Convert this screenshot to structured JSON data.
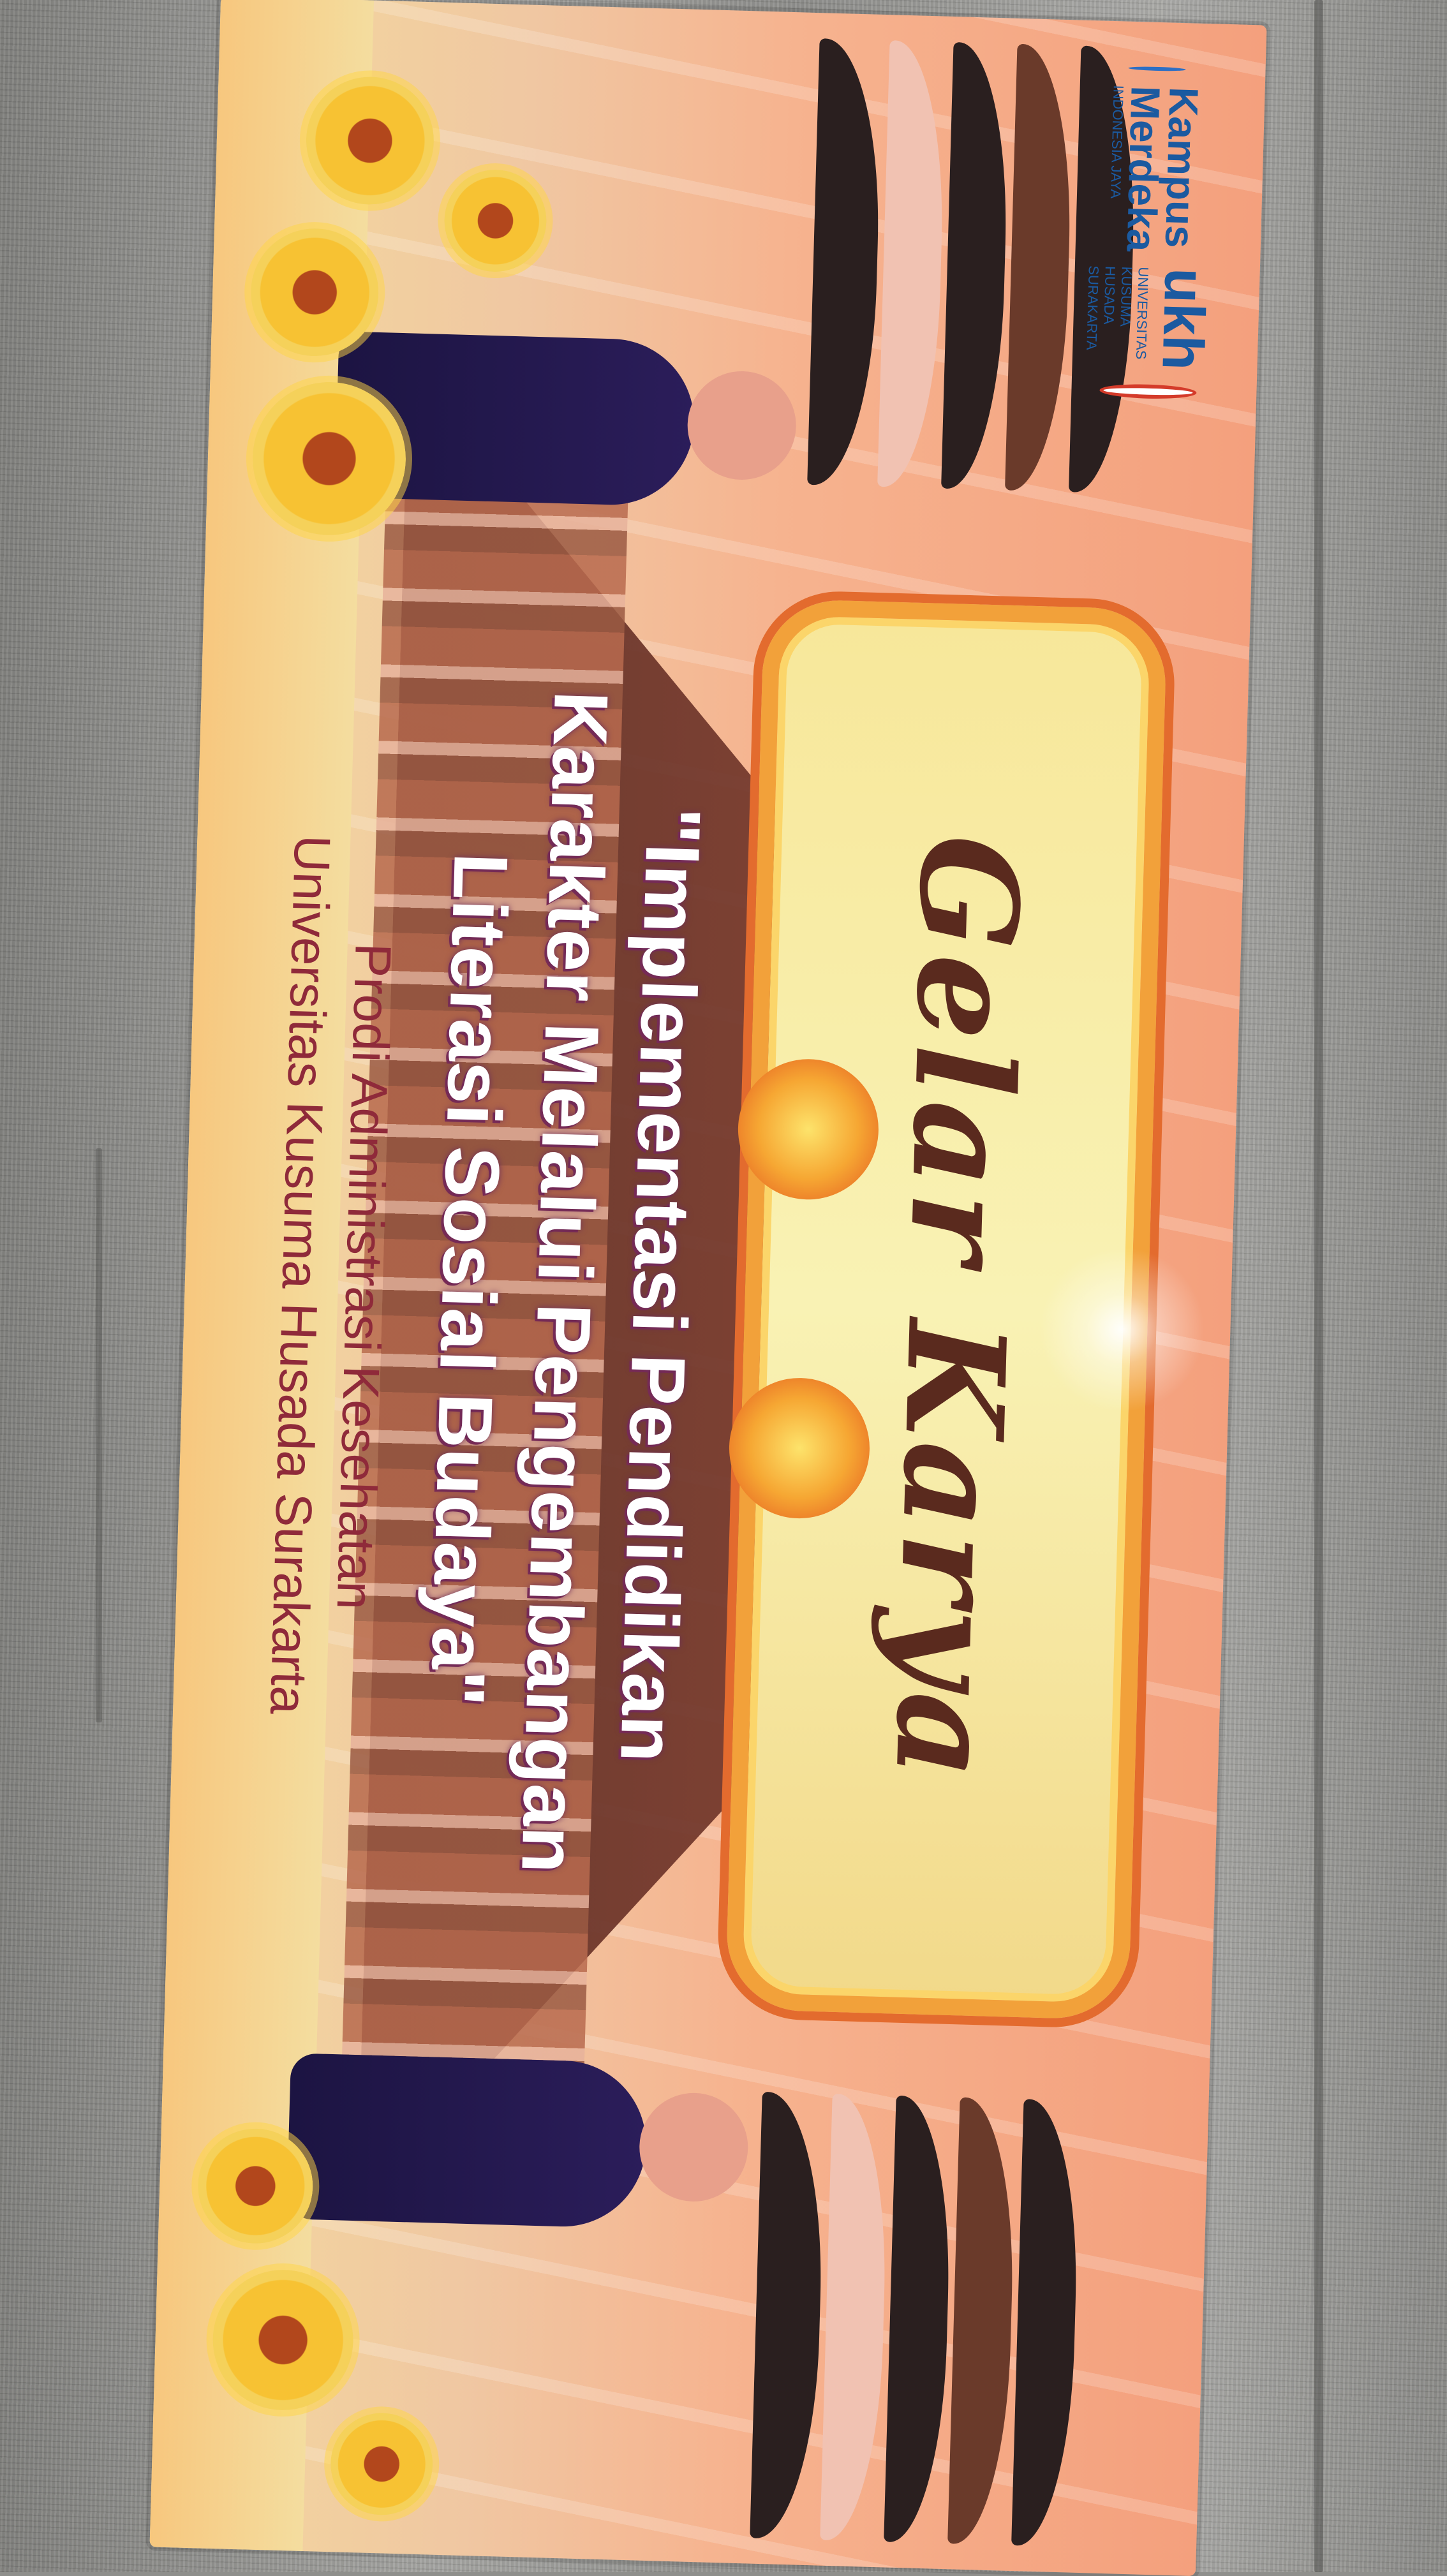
{
  "banner": {
    "title": "Gelar Karya",
    "subtitle_lines": [
      "\"Implementasi Pendidikan",
      "Karakter Melalui Pengembangan",
      "Literasi Sosial Budaya\""
    ],
    "prodi": "Prodi Administrasi Kesehatan",
    "university": "Universitas Kusuma Husada Surakarta"
  },
  "logos": {
    "ukh_mark": "ukh",
    "ukh_small": "UNIVERSITAS KUSUMA HUSADA SURAKARTA",
    "kampus_merdeka_line1": "Kampus",
    "kampus_merdeka_line2": "Merdeka",
    "kampus_merdeka_sub": "INDONESIA JAYA"
  },
  "colors": {
    "sky": "#f4a07d",
    "frame": "#f2a13a",
    "title": "#5a2a1e",
    "subtitle": "#ffffff",
    "prodi": "#8f2a3a",
    "ground": "#8f8f8c"
  }
}
